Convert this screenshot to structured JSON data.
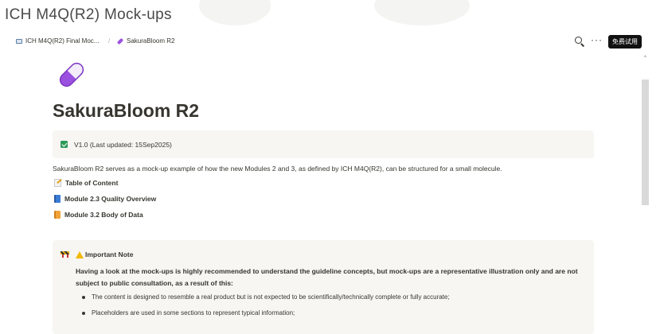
{
  "site": {
    "title": "ICH M4Q(R2) Mock-ups"
  },
  "breadcrumb": {
    "items": [
      {
        "label": "ICH M4Q(R2) Final Moc...",
        "icon": "book-icon"
      },
      {
        "label": "SakuraBloom R2",
        "icon": "pill-icon"
      }
    ],
    "separator": "/"
  },
  "toolbar": {
    "more_label": "···",
    "try_label": "免费试用"
  },
  "page": {
    "icon": "pill-icon",
    "title": "SakuraBloom R2",
    "version_text": "V1.0 (Last updated: 15Sep2025)",
    "description": "SakuraBloom R2 serves as a mock-up example of how the new Modules 2 and 3, as defined by ICH M4Q(R2), can be structured for a small molecule.",
    "links": [
      {
        "label": "Table of Content",
        "icon": "memo-icon"
      },
      {
        "label": "Module 2.3 Quality Overview",
        "icon": "blue-book-icon"
      },
      {
        "label": "Module 3.2 Body of Data",
        "icon": "orange-book-icon"
      }
    ]
  },
  "note": {
    "heading": "Important Note",
    "body": "Having a look at the mock-ups is highly recommended to understand the guideline concepts, but mock-ups are a representative illustration only and are not subject to public consultation, as a result of this:",
    "bullets": [
      "The content is designed to resemble a real product but is not expected to be scientifically/technically complete or fully accurate;",
      "Placeholders are used in some sections to represent typical information;"
    ]
  },
  "colors": {
    "accent_pill": "#9b51e0",
    "callout_bg": "#f7f6f3",
    "check_green": "#2e9a5a"
  }
}
